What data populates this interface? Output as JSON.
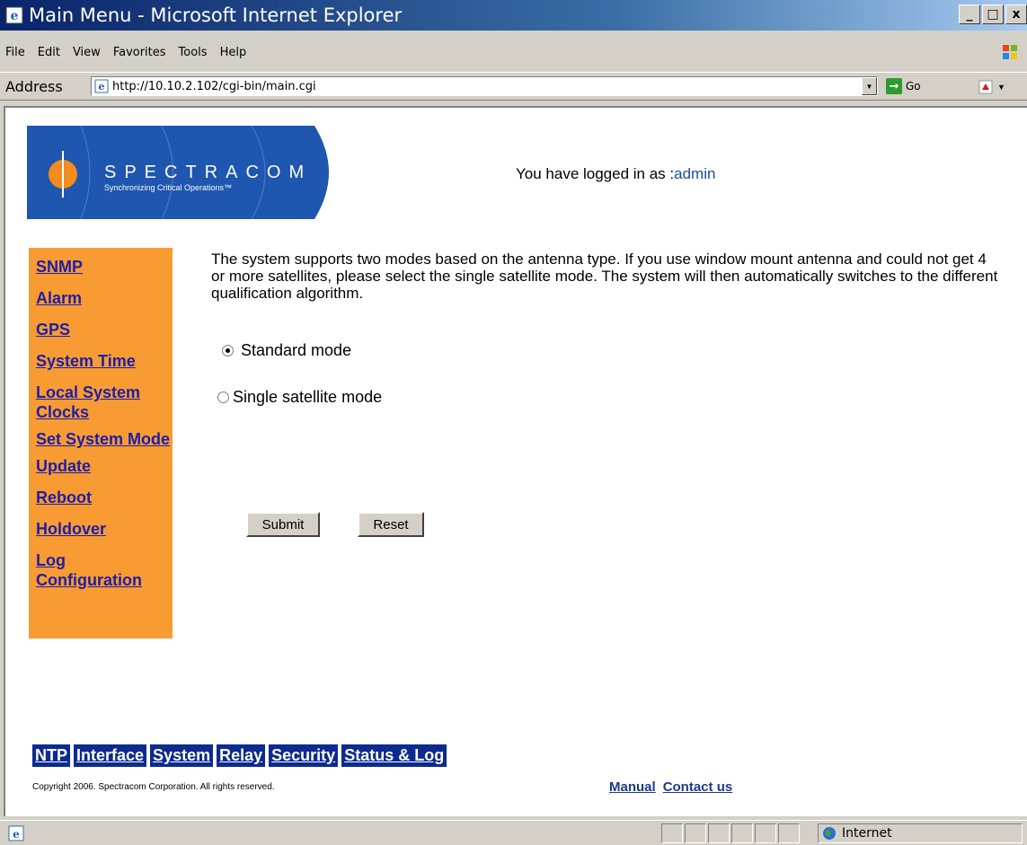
{
  "window": {
    "title": "Main Menu - Microsoft Internet Explorer",
    "minimize_label": "_",
    "maximize_label": "□",
    "close_label": "x"
  },
  "menubar": {
    "items": [
      "File",
      "Edit",
      "View",
      "Favorites",
      "Tools",
      "Help"
    ]
  },
  "addressbar": {
    "label": "Address",
    "url": "http://10.10.2.102/cgi-bin/main.cgi",
    "go_label": "Go"
  },
  "page": {
    "logo": {
      "name": "SPECTRACOM",
      "tagline": "Synchronizing Critical Operations™",
      "brand_color": "#1e56b0"
    },
    "login_prefix": "You have logged in as :",
    "login_user": "admin",
    "sidebar": {
      "color": "#f99b33",
      "items": [
        "SNMP",
        "Alarm",
        "GPS",
        "System Time",
        "Local System Clocks",
        "Set System Mode",
        "Update",
        "Reboot",
        "Holdover",
        "Log Configuration"
      ]
    },
    "description": "The system supports two modes based on the antenna type. If you use window mount antenna and could not get 4 or more satellites, please select the single satellite mode. The system will then automatically switches to the different qualification algorithm.",
    "modes": [
      {
        "label": "Standard mode",
        "selected": true
      },
      {
        "label": "Single satellite mode",
        "selected": false
      }
    ],
    "submit_label": "Submit",
    "reset_label": "Reset",
    "bottom_nav": [
      "NTP",
      "Interface",
      "System",
      "Relay",
      "Security",
      "Status & Log"
    ],
    "copyright": "Copyright 2006. Spectracom Corporation. All rights reserved.",
    "footer_links": [
      "Manual",
      "Contact us"
    ]
  },
  "statusbar": {
    "zone": "Internet"
  }
}
